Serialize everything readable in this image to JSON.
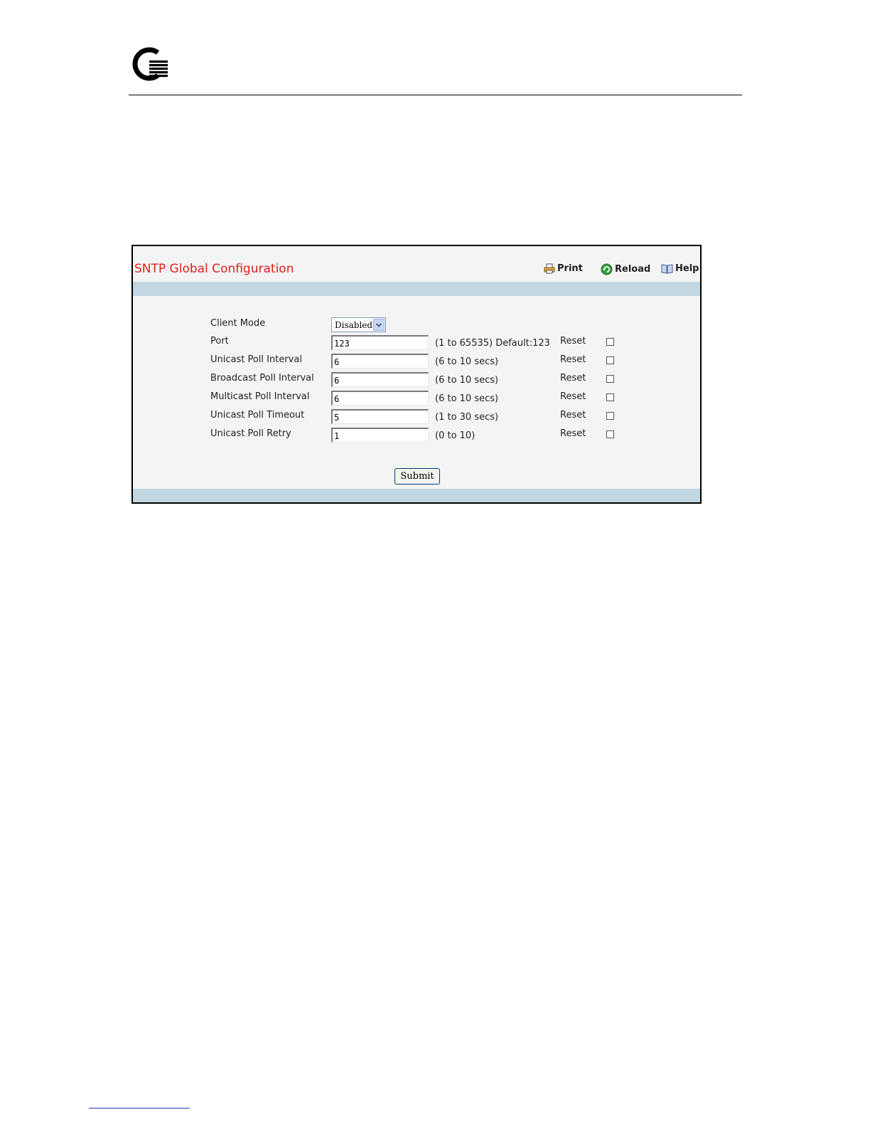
{
  "page": {
    "title": "SNTP Global Configuration",
    "toolbar": {
      "print_label": "Print",
      "reload_label": "Reload",
      "help_label": "Help"
    }
  },
  "form": {
    "client_mode": {
      "label": "Client Mode",
      "value": "Disabled"
    },
    "rows": [
      {
        "label": "Port",
        "value": "123",
        "hint": "(1 to 65535) Default:123",
        "reset_label": "Reset",
        "reset_checked": false
      },
      {
        "label": "Unicast Poll Interval",
        "value": "6",
        "hint": "(6 to 10 secs)",
        "reset_label": "Reset",
        "reset_checked": false
      },
      {
        "label": "Broadcast Poll Interval",
        "value": "6",
        "hint": "(6 to 10 secs)",
        "reset_label": "Reset",
        "reset_checked": false
      },
      {
        "label": "Multicast Poll Interval",
        "value": "6",
        "hint": "(6 to 10 secs)",
        "reset_label": "Reset",
        "reset_checked": false
      },
      {
        "label": "Unicast Poll Timeout",
        "value": "5",
        "hint": "(1 to 30 secs)",
        "reset_label": "Reset",
        "reset_checked": false
      },
      {
        "label": "Unicast Poll Retry",
        "value": "1",
        "hint": "(0 to 10)",
        "reset_label": "Reset",
        "reset_checked": false
      }
    ],
    "submit_label": "Submit"
  },
  "colors": {
    "title": "#e0201a",
    "band": "#c3d7e3",
    "panel_bg": "#f4f4f4"
  },
  "icons": [
    "company-logo-icon",
    "printer-icon",
    "reload-icon",
    "help-book-icon",
    "chevron-down-icon"
  ]
}
